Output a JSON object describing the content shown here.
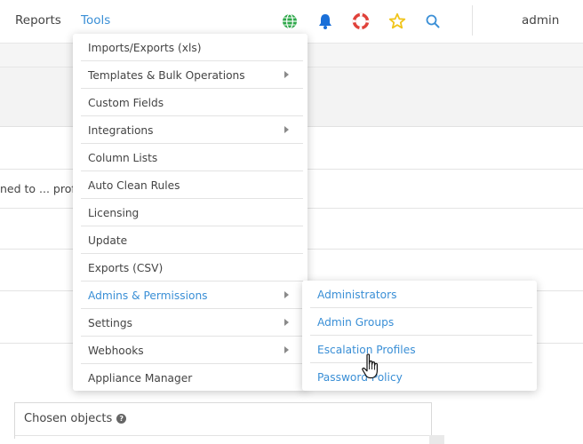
{
  "nav": {
    "reports_label": "Reports",
    "tools_label": "Tools",
    "user_label": "admin",
    "icons": [
      "globe-icon",
      "bell-icon",
      "lifebuoy-icon",
      "star-icon",
      "search-icon"
    ],
    "colors": {
      "globe": "#2ea84a",
      "bell": "#1a6fd8",
      "lifebuoy": "#e0413a",
      "star": "#f0c419",
      "search": "#3a8fd6",
      "active_link": "#3a8fd6"
    }
  },
  "background": {
    "row_text": "ned to ... prof",
    "chosen_title": "Chosen objects"
  },
  "menu": {
    "items": [
      {
        "label": "Imports/Exports (xls)",
        "has_submenu": false
      },
      {
        "label": "Templates & Bulk Operations",
        "has_submenu": true
      },
      {
        "label": "Custom Fields",
        "has_submenu": false
      },
      {
        "label": "Integrations",
        "has_submenu": true
      },
      {
        "label": "Column Lists",
        "has_submenu": false
      },
      {
        "label": "Auto Clean Rules",
        "has_submenu": false
      },
      {
        "label": "Licensing",
        "has_submenu": false
      },
      {
        "label": "Update",
        "has_submenu": false
      },
      {
        "label": "Exports (CSV)",
        "has_submenu": false
      },
      {
        "label": "Admins & Permissions",
        "has_submenu": true,
        "active": true
      },
      {
        "label": "Settings",
        "has_submenu": true
      },
      {
        "label": "Webhooks",
        "has_submenu": true
      },
      {
        "label": "Appliance Manager",
        "has_submenu": false
      }
    ]
  },
  "submenu": {
    "items": [
      {
        "label": "Administrators"
      },
      {
        "label": "Admin Groups"
      },
      {
        "label": "Escalation Profiles"
      },
      {
        "label": "Password Policy"
      }
    ]
  }
}
